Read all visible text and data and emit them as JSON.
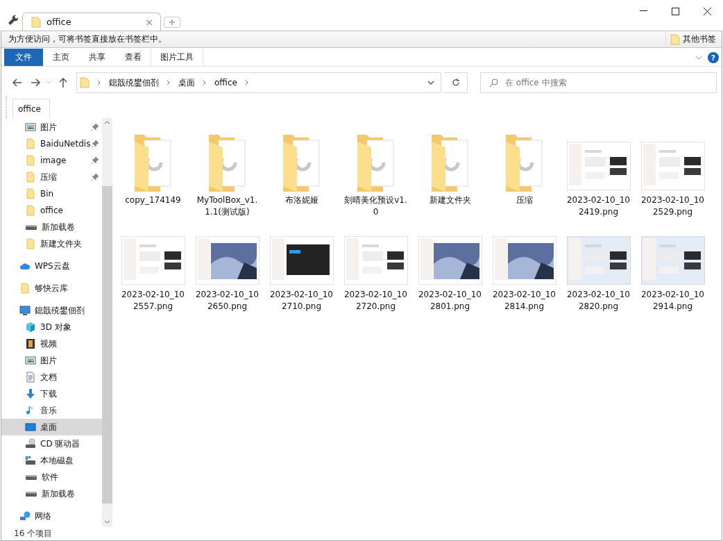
{
  "tab": {
    "title": "office",
    "close": "×"
  },
  "bookmarks_bar": {
    "hint": "为方便访问，可将书签直接放在书签栏中。",
    "other": "其他书签"
  },
  "ribbon": {
    "tabs": [
      {
        "label": "文件",
        "selected": true
      },
      {
        "label": "主页",
        "selected": false
      },
      {
        "label": "共享",
        "selected": false
      },
      {
        "label": "查看",
        "selected": false
      },
      {
        "label": "图片工具",
        "selected": false
      }
    ],
    "help": "?"
  },
  "address": {
    "crumbs": [
      "鎴戠殑鐢佃剳",
      "桌面",
      "office"
    ],
    "search_placeholder": "在 office 中搜索"
  },
  "location_tab": "office",
  "nav": {
    "quick_access": [
      {
        "label": "图片",
        "kind": "picture",
        "pinned": true,
        "selected": false
      },
      {
        "label": "BaiduNetdis",
        "kind": "folder",
        "pinned": true,
        "selected": false
      },
      {
        "label": "image",
        "kind": "folder",
        "pinned": true,
        "selected": false
      },
      {
        "label": "压缩",
        "kind": "folder",
        "pinned": true,
        "selected": false
      },
      {
        "label": "Bin",
        "kind": "folder",
        "pinned": false,
        "selected": false
      },
      {
        "label": "office",
        "kind": "folder",
        "pinned": false,
        "selected": false
      },
      {
        "label": "新加载卷",
        "kind": "drive",
        "pinned": false,
        "selected": false
      },
      {
        "label": "新建文件夹",
        "kind": "folder",
        "pinned": false,
        "selected": false
      }
    ],
    "roots": [
      {
        "label": "WPS云盘",
        "kind": "cloud",
        "selected": false
      },
      {
        "label": "够快云库",
        "kind": "folder",
        "selected": false
      },
      {
        "label": "鎴戠殑鐢佃剳",
        "kind": "pc",
        "selected": false,
        "children": [
          {
            "label": "3D 对象",
            "kind": "cube",
            "selected": false
          },
          {
            "label": "视频",
            "kind": "video",
            "selected": false
          },
          {
            "label": "图片",
            "kind": "picture",
            "selected": false
          },
          {
            "label": "文档",
            "kind": "doc",
            "selected": false
          },
          {
            "label": "下载",
            "kind": "download",
            "selected": false
          },
          {
            "label": "音乐",
            "kind": "music",
            "selected": false
          },
          {
            "label": "桌面",
            "kind": "desktop",
            "selected": true
          },
          {
            "label": "CD 驱动器",
            "kind": "cd",
            "selected": false
          },
          {
            "label": "本地磁盘",
            "kind": "localdisk",
            "selected": false
          },
          {
            "label": "软件",
            "kind": "drive",
            "selected": false
          },
          {
            "label": "新加载卷",
            "kind": "drive",
            "selected": false
          }
        ]
      },
      {
        "label": "网络",
        "kind": "network",
        "selected": false
      }
    ]
  },
  "files": [
    {
      "name": "copy_174149",
      "kind": "folder"
    },
    {
      "name": "MyToolBox_v1.1.1(测试版)",
      "kind": "folder"
    },
    {
      "name": "布洛妮娅",
      "kind": "folder"
    },
    {
      "name": "刻晴美化预设v1.0",
      "kind": "folder"
    },
    {
      "name": "新建文件夹",
      "kind": "folder"
    },
    {
      "name": "压缩",
      "kind": "folder"
    },
    {
      "name": "2023-02-10_102419.png",
      "kind": "picture"
    },
    {
      "name": "2023-02-10_102529.png",
      "kind": "picture"
    },
    {
      "name": "2023-02-10_102557.png",
      "kind": "picture"
    },
    {
      "name": "2023-02-10_102650.png",
      "kind": "picture"
    },
    {
      "name": "2023-02-10_102710.png",
      "kind": "picture"
    },
    {
      "name": "2023-02-10_102720.png",
      "kind": "picture"
    },
    {
      "name": "2023-02-10_102801.png",
      "kind": "picture"
    },
    {
      "name": "2023-02-10_102814.png",
      "kind": "picture"
    },
    {
      "name": "2023-02-10_102820.png",
      "kind": "picture"
    },
    {
      "name": "2023-02-10_102914.png",
      "kind": "picture"
    }
  ],
  "status": "16 个项目"
}
